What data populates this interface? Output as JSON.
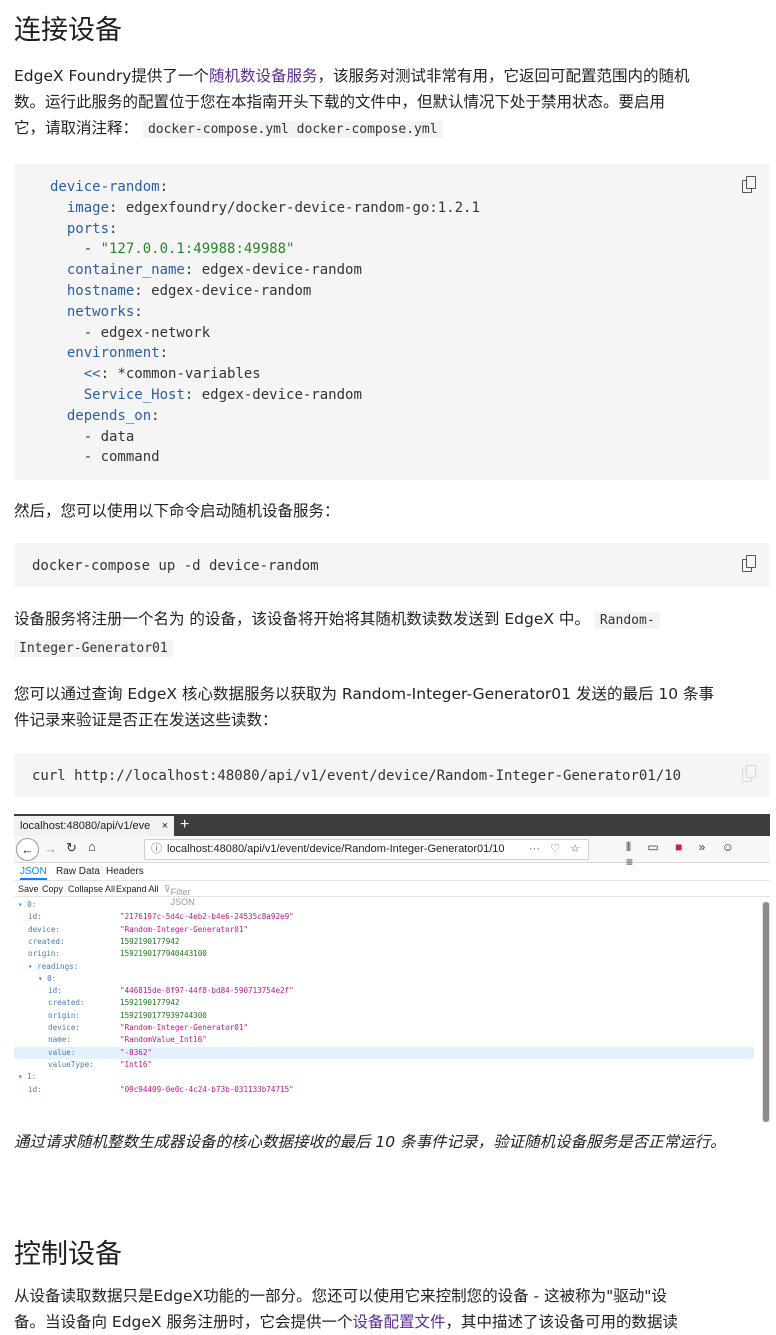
{
  "section1": {
    "heading": "连接设备",
    "intro_before_link": "EdgeX Foundry提供了一个",
    "intro_link": "随机数设备服务",
    "intro_line1_after": "，该服务对测试非常有用，它返回可配置范围内的随机",
    "intro_line2": "数。运行此服务的配置位于您在本指南开头下载的文件中，但默认情况下处于禁用状态。要启用",
    "intro_line3": "它，请取消注释：",
    "intro_code": "docker-compose.yml docker-compose.yml",
    "yaml": {
      "service": "device-random",
      "image_key": "image",
      "image_val": "edgexfoundry/docker-device-random-go:1.2.1",
      "ports_key": "ports",
      "port_val": "\"127.0.0.1:49988:49988\"",
      "container_key": "container_name",
      "container_val": "edgex-device-random",
      "hostname_key": "hostname",
      "hostname_val": "edgex-device-random",
      "networks_key": "networks",
      "networks_val": "edgex-network",
      "environment_key": "environment",
      "merge_key": "<<",
      "merge_val": "*common-variables",
      "service_host_key": "Service_Host",
      "service_host_val": "edgex-device-random",
      "depends_key": "depends_on",
      "depends_1": "data",
      "depends_2": "command"
    },
    "then_text": "然后，您可以使用以下命令启动随机设备服务：",
    "start_cmd": "docker-compose up -d device-random",
    "register_text": "设备服务将注册一个名为 的设备，该设备将开始将其随机数读数发送到 EdgeX 中。",
    "device_code_a": "Random-",
    "device_code_b": "Integer-Generator01",
    "verify_line1": "您可以通过查询 EdgeX 核心数据服务以获取为 Random-Integer-Generator01 发送的最后 10 条事",
    "verify_line2": "件记录来验证是否正在发送这些读数：",
    "curl_cmd": "curl http://localhost:48080/api/v1/event/device/Random-Integer-Generator01/10"
  },
  "browser": {
    "tab_title": "localhost:48080/api/v1/eve",
    "tab_close": "×",
    "new_tab": "+",
    "url": "localhost:48080/api/v1/event/device/Random-Integer-Generator01/10",
    "url_info": "ⓘ",
    "url_more": "···",
    "view_tabs": [
      "JSON",
      "Raw Data",
      "Headers"
    ],
    "tools": [
      "Save",
      "Copy",
      "Collapse All",
      "Expand All",
      "Filter JSON"
    ],
    "tree": [
      {
        "key": "▾ 0:",
        "val": "",
        "kind": "none",
        "indent": 0
      },
      {
        "key": "id:",
        "val": "\"2176197c-5d4c-4eb2-b4e6-24535c8a92e9\"",
        "kind": "str",
        "indent": 2
      },
      {
        "key": "device:",
        "val": "\"Random-Integer-Generator01\"",
        "kind": "str",
        "indent": 2
      },
      {
        "key": "created:",
        "val": "1592190177942",
        "kind": "num",
        "indent": 2
      },
      {
        "key": "origin:",
        "val": "1592190177940443100",
        "kind": "num",
        "indent": 2
      },
      {
        "key": "▾ readings:",
        "val": "",
        "kind": "none",
        "indent": 2
      },
      {
        "key": "▾ 0:",
        "val": "",
        "kind": "none",
        "indent": 4
      },
      {
        "key": "id:",
        "val": "\"446815de-8f97-44f8-bd84-590713754e2f\"",
        "kind": "str",
        "indent": 6
      },
      {
        "key": "created:",
        "val": "1592190177942",
        "kind": "num",
        "indent": 6
      },
      {
        "key": "origin:",
        "val": "1592190177939744300",
        "kind": "num",
        "indent": 6
      },
      {
        "key": "device:",
        "val": "\"Random-Integer-Generator01\"",
        "kind": "str",
        "indent": 6
      },
      {
        "key": "name:",
        "val": "\"RandomValue_Int16\"",
        "kind": "str",
        "indent": 6
      },
      {
        "key": "value:",
        "val": "\"-8362\"",
        "kind": "str",
        "indent": 6,
        "selected": true
      },
      {
        "key": "valueType:",
        "val": "\"Int16\"",
        "kind": "str",
        "indent": 6
      },
      {
        "key": "▾ 1:",
        "val": "",
        "kind": "none",
        "indent": 0
      },
      {
        "key": "id:",
        "val": "\"09c94409-0e0c-4c24-b73b-031133b74715\"",
        "kind": "str",
        "indent": 2
      }
    ]
  },
  "caption": "通过请求随机整数生成器设备的核心数据接收的最后 10 条事件记录，验证随机设备服务是否正常运行。",
  "section2": {
    "heading": "控制设备",
    "line1": "从设备读取数据只是EdgeX功能的一部分。您还可以使用它来控制您的设备 - 这被称为\"驱动\"设",
    "line2_before": "备。当设备向 EdgeX 服务注册时，它会提供一个",
    "line2_link": "设备配置文件",
    "line2_after": "，其中描述了该设备可用的数据读"
  }
}
